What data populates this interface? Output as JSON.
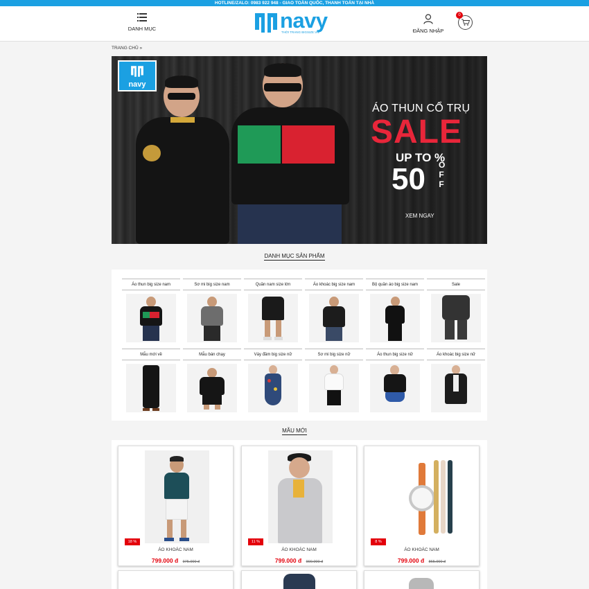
{
  "topbar": {
    "text": "HOTLINE/ZALO: 0983 922 948 - GIAO TOÀN QUỐC, THANH TOÁN TẠI NHÀ"
  },
  "header": {
    "menu_label": "DANH MỤC",
    "logo_text": "navy",
    "logo_tagline": "THỜI TRANG BIGSIZE.VN",
    "login_label": "ĐĂNG NHẬP",
    "cart_count": "0"
  },
  "breadcrumb": {
    "home": "TRANG CHỦ",
    "separator": "»"
  },
  "banner": {
    "logo_text": "navy",
    "headline": "ÁO THUN CỔ TRỤ",
    "sale": "SALE",
    "up_to": "UP TO %",
    "percent": "50",
    "off": "OFF",
    "cta": "XEM NGAY"
  },
  "categories": {
    "title": "DANH MỤC SẢN PHẨM",
    "items": [
      {
        "label": "Áo thun big size nam"
      },
      {
        "label": "Sơ mi big size nam"
      },
      {
        "label": "Quần nam size lớn"
      },
      {
        "label": "Áo khoác big size nam"
      },
      {
        "label": "Bộ quần áo big size nam"
      },
      {
        "label": "Sale"
      },
      {
        "label": "Mẫu mới về"
      },
      {
        "label": "Mẫu bán chạy"
      },
      {
        "label": "Váy đầm big size nữ"
      },
      {
        "label": "Sơ mi big size nữ"
      },
      {
        "label": "Áo thun big size nữ"
      },
      {
        "label": "Áo khoác big size nữ"
      }
    ]
  },
  "new_products": {
    "title": "MẪU MỚI",
    "items": [
      {
        "name": "ÁO KHOÁC NAM",
        "discount": "18 %",
        "price": "799.000 đ",
        "old_price": "975.000 đ"
      },
      {
        "name": "ÁO KHOÁC NAM",
        "discount": "11 %",
        "price": "799.000 đ",
        "old_price": "900.000 đ"
      },
      {
        "name": "ÁO KHOÁC NAM",
        "discount": "8 %",
        "price": "799.000 đ",
        "old_price": "865.000 đ"
      }
    ]
  },
  "colors": {
    "brand": "#1ba0e2",
    "sale_red": "#e3000b",
    "banner_red": "#e8263a"
  },
  "icons": [
    "menu-icon",
    "user-icon",
    "cart-icon",
    "chevron-right-icon"
  ]
}
